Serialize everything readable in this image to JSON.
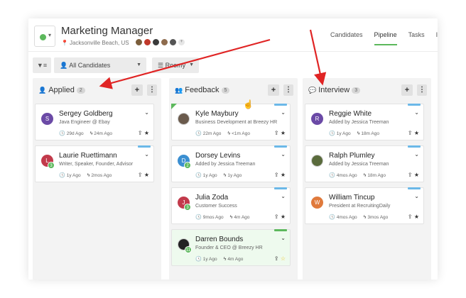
{
  "header": {
    "title": "Marketing Manager",
    "location": "Jacksonville Beach, US",
    "team_more": "+",
    "team_colors": [
      "#7b5e3c",
      "#c0392b",
      "#3a3a3a",
      "#8e6b4d",
      "#555555"
    ]
  },
  "nav": {
    "tabs": [
      {
        "label": "Candidates",
        "active": false
      },
      {
        "label": "Pipeline",
        "active": true
      },
      {
        "label": "Tasks",
        "active": false
      },
      {
        "label": "Inbox",
        "active": false
      }
    ]
  },
  "toolbar": {
    "filter_icon": "filter-icon",
    "select_label": "All Candidates",
    "view_label": "Roomy"
  },
  "columns": [
    {
      "title": "Applied",
      "count": "2",
      "icon": "user-icon",
      "add_label": "+",
      "more_label": "⋮",
      "cards": [
        {
          "name": "Sergey Goldberg",
          "subtitle": "Java Engineer @ Ebay",
          "time1": "29d Ago",
          "time2": "24m Ago",
          "avatar_letter": "S",
          "avatar_color": "#6b4aa6",
          "badge": "",
          "strip": "",
          "corner": false,
          "green": false,
          "star_gold": false
        },
        {
          "name": "Laurie Ruettimann",
          "subtitle": "Writer, Speaker, Founder, Advisor",
          "time1": "1y Ago",
          "time2": "2mos Ago",
          "avatar_letter": "L",
          "avatar_color": "#c23a4b",
          "badge": "3",
          "strip": "blue",
          "corner": false,
          "green": false,
          "star_gold": false
        }
      ]
    },
    {
      "title": "Feedback",
      "count": "5",
      "icon": "users-icon",
      "add_label": "+",
      "more_label": "⋮",
      "cards": [
        {
          "name": "Kyle Maybury",
          "subtitle": "Business Development at Breezy HR",
          "time1": "22m Ago",
          "time2": "<1m Ago",
          "avatar_letter": "",
          "avatar_color": "#6a5a4c",
          "badge": "",
          "strip": "blue",
          "corner": true,
          "green": false,
          "star_gold": false
        },
        {
          "name": "Dorsey Levins",
          "subtitle": "Added by Jessica Treeman",
          "time1": "1y Ago",
          "time2": "1y Ago",
          "avatar_letter": "D",
          "avatar_color": "#3b8fd1",
          "badge": "2",
          "strip": "blue",
          "corner": false,
          "green": false,
          "star_gold": false
        },
        {
          "name": "Julia Zoda",
          "subtitle": "Customer Success",
          "time1": "9mos Ago",
          "time2": "4m Ago",
          "avatar_letter": "J",
          "avatar_color": "#c23a4b",
          "badge": "3",
          "strip": "blue",
          "corner": false,
          "green": false,
          "star_gold": false
        },
        {
          "name": "Darren Bounds",
          "subtitle": "Founder & CEO @ Breezy HR",
          "time1": "1y Ago",
          "time2": "4m Ago",
          "avatar_letter": "",
          "avatar_color": "#222222",
          "badge": "11",
          "strip": "green",
          "corner": false,
          "green": true,
          "star_gold": true
        }
      ]
    },
    {
      "title": "Interview",
      "count": "3",
      "icon": "comments-icon",
      "add_label": "+",
      "more_label": "⋮",
      "cards": [
        {
          "name": "Reggie White",
          "subtitle": "Added by Jessica Treeman",
          "time1": "1y Ago",
          "time2": "18m Ago",
          "avatar_letter": "R",
          "avatar_color": "#6b4aa6",
          "badge": "",
          "strip": "blue",
          "corner": false,
          "green": false,
          "star_gold": false
        },
        {
          "name": "Ralph Plumley",
          "subtitle": "Added by Jessica Treeman",
          "time1": "4mos Ago",
          "time2": "18m Ago",
          "avatar_letter": "",
          "avatar_color": "#5a6b3c",
          "badge": "",
          "strip": "blue",
          "corner": false,
          "green": false,
          "star_gold": false
        },
        {
          "name": "William Tincup",
          "subtitle": "President at RecruitingDaily",
          "time1": "4mos Ago",
          "time2": "3mos Ago",
          "avatar_letter": "W",
          "avatar_color": "#e07a3c",
          "badge": "",
          "strip": "blue",
          "corner": false,
          "green": false,
          "star_gold": false
        }
      ]
    }
  ],
  "card_labels": {
    "time1_icon": "clock-icon",
    "time2_icon": "bolt-icon",
    "expand_icon": "chevron-down-icon",
    "move_icon": "upload-icon",
    "star_icon": "star-icon"
  },
  "colors": {
    "accent_green": "#5cb85c",
    "strip_blue": "#6bb8e8",
    "annotation_red": "#e02424"
  }
}
